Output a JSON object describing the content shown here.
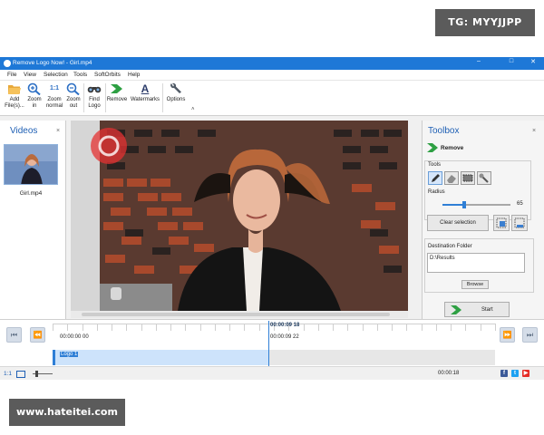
{
  "watermarks": {
    "top": "TG: MYYJJPP",
    "bottom": "www.hateitei.com"
  },
  "window": {
    "title": "Remove Logo Now! - Girl.mp4",
    "controls": {
      "minimize": "–",
      "maximize": "□",
      "close": "✕"
    }
  },
  "menu": [
    "File",
    "View",
    "Selection",
    "Tools",
    "SoftOrbits",
    "Help"
  ],
  "ribbon": {
    "add_files": "Add\nFile(s)...",
    "zoom_in": "Zoom\nin",
    "zoom_normal": "Zoom\nnormal",
    "zoom_normal_glyph": "1:1",
    "zoom_out": "Zoom\nout",
    "find_logo": "Find\nLogo",
    "remove": "Remove",
    "watermarks": "Watermarks",
    "watermarks_glyph": "A",
    "options": "Options",
    "collapse_glyph": "˄"
  },
  "videos_panel": {
    "title": "Videos",
    "close": "×",
    "items": [
      {
        "name": "Girl.mp4"
      }
    ]
  },
  "toolbox": {
    "title": "Toolbox",
    "close": "×",
    "mode": "Remove",
    "tools_label": "Tools",
    "radius_label": "Radius",
    "radius_value": "65",
    "radius_fraction": 0.32,
    "clear_selection": "Clear selection",
    "destination_label": "Destination Folder",
    "destination_path": "D:\\Results",
    "browse": "Browse",
    "start": "Start"
  },
  "timeline": {
    "start_time": "00:00:00 00",
    "cursor_time": "00:00:09 18",
    "cursor_time_frames": "00:00:09 22",
    "track_label": "Logo 1",
    "nav_first": "⏮",
    "nav_prev": "⏪",
    "nav_next": "⏩",
    "nav_last": "⏭"
  },
  "statusbar": {
    "zoom": "1:1",
    "duration": "00:00:18",
    "social": [
      "f",
      "t",
      "▶"
    ]
  },
  "colors": {
    "accent": "#1e78d7",
    "title_blue": "#1e5fb4",
    "facebook": "#3b5998",
    "twitter": "#1da1f2",
    "youtube": "#e52d27"
  }
}
